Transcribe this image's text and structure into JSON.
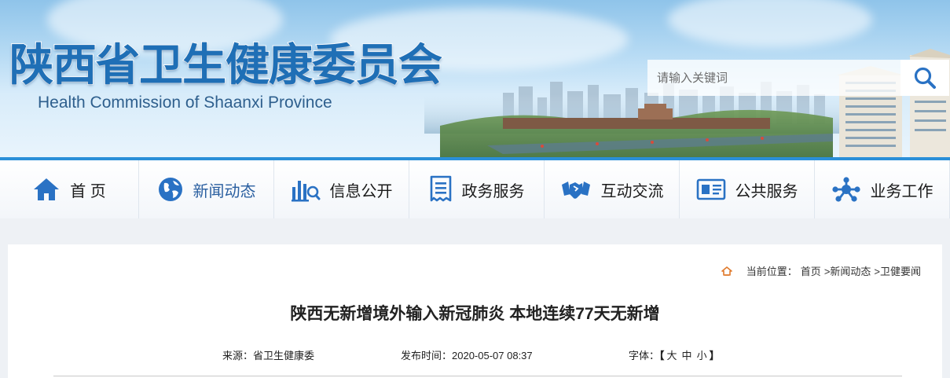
{
  "site": {
    "title_cn": "陕西省卫生健康委员会",
    "title_en": "Health Commission of Shaanxi Province"
  },
  "search": {
    "placeholder": "请输入关键词"
  },
  "nav": {
    "items": [
      {
        "label": "首 页",
        "icon": "home-icon"
      },
      {
        "label": "新闻动态",
        "icon": "globe-icon",
        "active": true
      },
      {
        "label": "信息公开",
        "icon": "chart-search-icon"
      },
      {
        "label": "政务服务",
        "icon": "document-icon"
      },
      {
        "label": "互动交流",
        "icon": "handshake-icon"
      },
      {
        "label": "公共服务",
        "icon": "id-card-icon"
      },
      {
        "label": "业务工作",
        "icon": "network-icon"
      }
    ]
  },
  "breadcrumb": {
    "prefix": "当前位置：",
    "items": [
      "首页",
      ">新闻动态",
      ">卫健要闻"
    ]
  },
  "article": {
    "title": "陕西无新增境外输入新冠肺炎 本地连续77天无新增",
    "source": "来源：省卫生健康委",
    "publish_time": "发布时间：2020-05-07 08:37",
    "font_size_label": "字体：",
    "font_size_open": "【",
    "font_sizes": [
      "大",
      "中",
      "小"
    ],
    "font_size_close": "】"
  },
  "colors": {
    "nav_accent": "#2a8fd8",
    "brand_blue": "#1f6fb6",
    "icon_blue": "#2a72c4"
  }
}
